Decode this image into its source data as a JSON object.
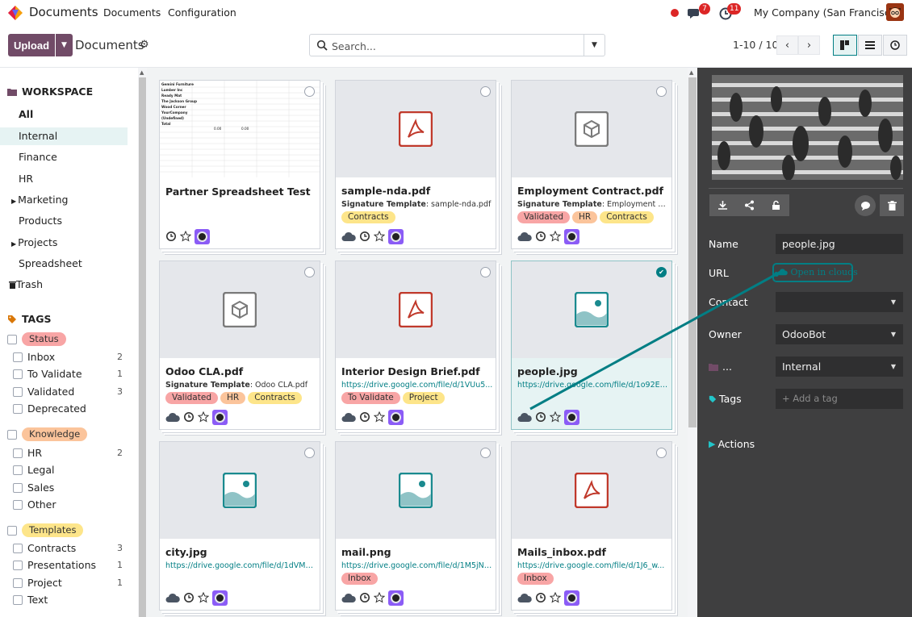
{
  "topbar": {
    "app_title": "Documents",
    "nav": [
      "Documents",
      "Configuration"
    ],
    "chat_badge": "7",
    "activity_badge": "11",
    "company": "My Company (San Francisco)"
  },
  "control": {
    "upload_label": "Upload",
    "breadcrumb": "Documents",
    "search_placeholder": "Search...",
    "pager": "1-10 / 10"
  },
  "sidebar": {
    "workspace_header": "WORKSPACE",
    "workspaces": [
      {
        "label": "All",
        "bold": true
      },
      {
        "label": "Internal",
        "active": true
      },
      {
        "label": "Finance"
      },
      {
        "label": "HR"
      },
      {
        "label": "Marketing",
        "expandable": true
      },
      {
        "label": "Products"
      },
      {
        "label": "Projects",
        "expandable": true
      },
      {
        "label": "Spreadsheet"
      },
      {
        "label": "Trash",
        "trash": true
      }
    ],
    "tags_header": "TAGS",
    "tag_groups": [
      {
        "label": "Status",
        "color": "#f8a5a5",
        "items": [
          {
            "label": "Inbox",
            "count": "2"
          },
          {
            "label": "To Validate",
            "count": "1"
          },
          {
            "label": "Validated",
            "count": "3"
          },
          {
            "label": "Deprecated",
            "count": ""
          }
        ]
      },
      {
        "label": "Knowledge",
        "color": "#fbc49b",
        "items": [
          {
            "label": "HR",
            "count": "2"
          },
          {
            "label": "Legal",
            "count": ""
          },
          {
            "label": "Sales",
            "count": ""
          },
          {
            "label": "Other",
            "count": ""
          }
        ]
      },
      {
        "label": "Templates",
        "color": "#fde58a",
        "items": [
          {
            "label": "Contracts",
            "count": "3"
          },
          {
            "label": "Presentations",
            "count": "1"
          },
          {
            "label": "Project",
            "count": "1"
          },
          {
            "label": "Text",
            "count": ""
          }
        ]
      }
    ]
  },
  "spreadsheet_preview": [
    "Gemini Furniture",
    "Lumber Inc",
    "Ready Mat",
    "The Jackson Group",
    "Wood Corner",
    "YourCompany",
    "(Undefined)",
    "Total"
  ],
  "spreadsheet_total_a": "0.00",
  "spreadsheet_total_b": "0.00",
  "cards": [
    {
      "title": "Partner Spreadsheet Test",
      "type": "sheet",
      "tags": [],
      "cloud": false
    },
    {
      "title": "sample-nda.pdf",
      "type": "pdf",
      "sub_label": "Signature Template",
      "sub_value": ": sample-nda.pdf",
      "tags": [
        {
          "label": "Contracts",
          "color": "#fde58a"
        }
      ],
      "cloud": true
    },
    {
      "title": "Employment Contract.pdf",
      "type": "box",
      "sub_label": "Signature Template",
      "sub_value": ": Employment Co...",
      "tags": [
        {
          "label": "Validated",
          "color": "#f8a5a5"
        },
        {
          "label": "HR",
          "color": "#fbc49b"
        },
        {
          "label": "Contracts",
          "color": "#fde58a"
        }
      ],
      "cloud": true
    },
    {
      "title": "Odoo CLA.pdf",
      "type": "box",
      "sub_label": "Signature Template",
      "sub_value": ": Odoo CLA.pdf",
      "tags": [
        {
          "label": "Validated",
          "color": "#f8a5a5"
        },
        {
          "label": "HR",
          "color": "#fbc49b"
        },
        {
          "label": "Contracts",
          "color": "#fde58a"
        }
      ],
      "cloud": true
    },
    {
      "title": "Interior Design Brief.pdf",
      "type": "pdf",
      "url": "https://drive.google.com/file/d/1VUu5...",
      "tags": [
        {
          "label": "To Validate",
          "color": "#f8a5a5"
        },
        {
          "label": "Project",
          "color": "#fde58a"
        }
      ],
      "cloud": true
    },
    {
      "title": "people.jpg",
      "type": "image",
      "url": "https://drive.google.com/file/d/1o92Eu...",
      "tags": [],
      "cloud": true,
      "selected": true
    },
    {
      "title": "city.jpg",
      "type": "image",
      "url": "https://drive.google.com/file/d/1dVM4...",
      "tags": [],
      "cloud": true
    },
    {
      "title": "mail.png",
      "type": "image",
      "url": "https://drive.google.com/file/d/1M5jNY...",
      "tags": [
        {
          "label": "Inbox",
          "color": "#f8a5a5"
        }
      ],
      "cloud": true
    },
    {
      "title": "Mails_inbox.pdf",
      "type": "pdf",
      "url": "https://drive.google.com/file/d/1J6_w...",
      "tags": [
        {
          "label": "Inbox",
          "color": "#f8a5a5"
        }
      ],
      "cloud": true
    }
  ],
  "panel": {
    "name_label": "Name",
    "name_value": "people.jpg",
    "url_label": "URL",
    "url_button": "Open in clouds",
    "contact_label": "Contact",
    "contact_value": "",
    "owner_label": "Owner",
    "owner_value": "OdooBot",
    "workspace_label": "...",
    "workspace_value": "Internal",
    "tags_label": "Tags",
    "tags_placeholder": "+ Add a tag",
    "actions_label": "Actions"
  },
  "colors": {
    "brand": "#714B67",
    "accent": "#017e84",
    "panel_bg": "#3f3f40"
  }
}
